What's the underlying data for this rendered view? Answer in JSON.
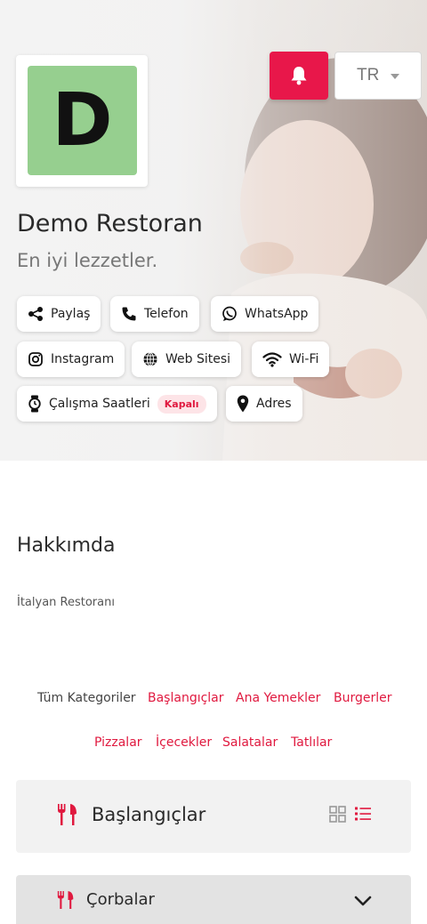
{
  "header": {
    "restaurant_name": "Demo Restoran",
    "slogan": "En iyi lezzetler.",
    "logo_letter": "D",
    "language": "TR",
    "accent_color": "#e8174a",
    "logo_bg_color": "#96cf8f"
  },
  "actions": {
    "share": "Paylaş",
    "phone": "Telefon",
    "whatsapp": "WhatsApp",
    "instagram": "Instagram",
    "website": "Web Sitesi",
    "wifi": "Wi-Fi",
    "hours": "Çalışma Saatleri",
    "hours_status": "Kapalı",
    "address": "Adres"
  },
  "about": {
    "title": "Hakkımda",
    "text": "İtalyan Restoranı"
  },
  "categories": [
    "Tüm Kategoriler",
    "Başlangıçlar",
    "Ana Yemekler",
    "Burgerler",
    "Pizzalar",
    "İçecekler",
    "Salatalar",
    "Tatlılar"
  ],
  "section": {
    "title": "Başlangıçlar",
    "subsection_title": "Çorbalar"
  },
  "icons": {
    "bell": "bell-icon",
    "share": "share-icon",
    "phone": "phone-icon",
    "whatsapp": "whatsapp-icon",
    "instagram": "instagram-icon",
    "website": "globe-icon",
    "wifi": "wifi-icon",
    "hours": "watch-icon",
    "address": "map-pin-icon",
    "section": "utensils-icon",
    "grid_view": "grid-icon",
    "list_view": "list-icon",
    "expand": "chevron-down-icon"
  }
}
